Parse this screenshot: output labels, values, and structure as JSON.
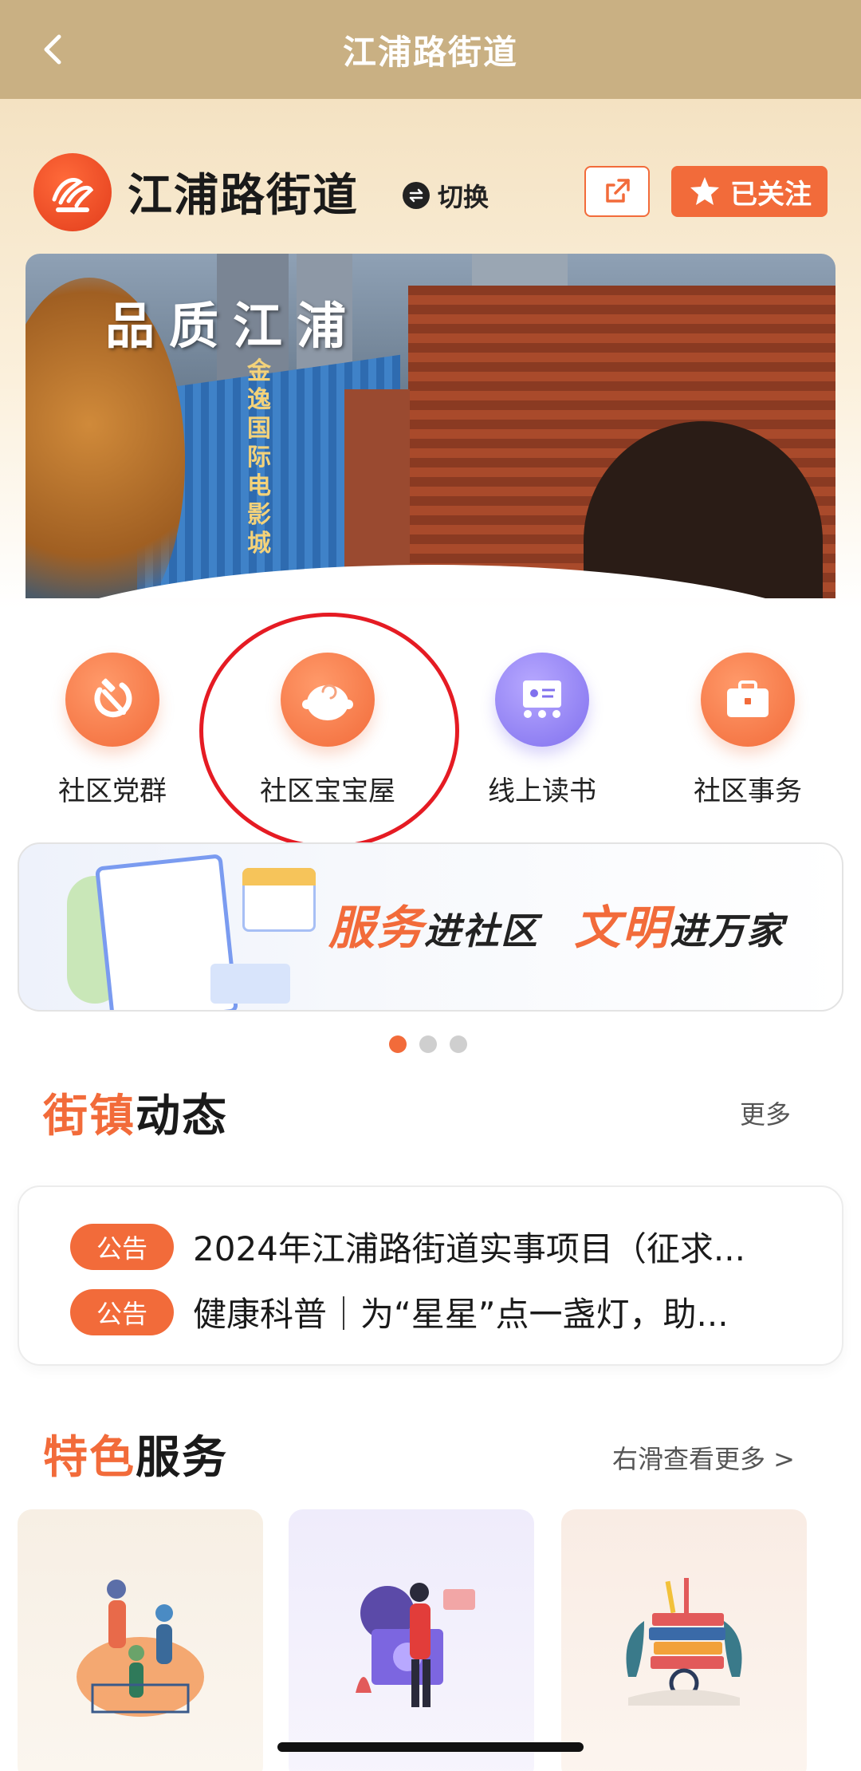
{
  "titlebar": {
    "title": "江浦路街道"
  },
  "header": {
    "site_name": "江浦路街道",
    "switch_label": "切换",
    "follow_label": "已关注"
  },
  "banner": {
    "slogan": "品质江浦",
    "signage": "金逸国际电影城"
  },
  "quick_links": [
    {
      "label": "社区党群",
      "icon": "hammer-sickle-icon",
      "color": "#f47a4a"
    },
    {
      "label": "社区宝宝屋",
      "icon": "baby-face-icon",
      "color": "#f47a4a"
    },
    {
      "label": "线上读书",
      "icon": "online-class-icon",
      "color": "#8b7cf0"
    },
    {
      "label": "社区事务",
      "icon": "briefcase-icon",
      "color": "#f47a4a"
    }
  ],
  "promo": {
    "part1_orange": "服务",
    "part1_black": "进社区",
    "part2_orange": "文明",
    "part2_black": "进万家"
  },
  "carousel": {
    "total": 3,
    "active": 1
  },
  "news_section": {
    "title_orange": "街镇",
    "title_black": "动态",
    "more": "更多",
    "items": [
      {
        "tag": "公告",
        "text": "2024年江浦路街道实事项目（征求..."
      },
      {
        "tag": "公告",
        "text": "健康科普｜为“星星”点一盏灯，助..."
      }
    ]
  },
  "feature_section": {
    "title_orange": "特色",
    "title_black": "服务",
    "more": "右滑查看更多 >"
  },
  "colors": {
    "accent": "#f26b3a",
    "titlebar": "#c9b083",
    "highlight_circle": "#e51b23"
  }
}
